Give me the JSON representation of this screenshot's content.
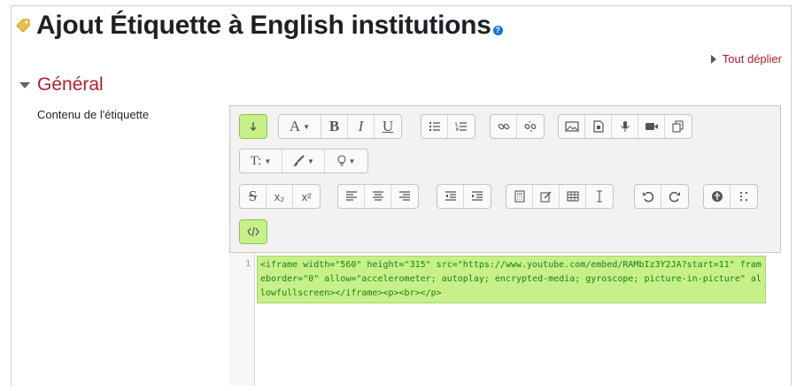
{
  "page": {
    "title": "Ajout Étiquette à English institutions",
    "help_icon": "?",
    "expand_all": "Tout déplier"
  },
  "section": {
    "title": "Général",
    "field_label": "Contenu de l'étiquette"
  },
  "toolbar": {
    "font_label": "A",
    "bold_label": "B",
    "italic_label": "I",
    "underline_label": "U",
    "style_label": "T:",
    "subscript_label": "x₂",
    "superscript_label": "x²"
  },
  "editor": {
    "line_number": "1",
    "code": "<iframe width=\"560\" height=\"315\" src=\"https://www.youtube.com/embed/RAMbIz3Y2JA?start=11\" frameborder=\"0\" allow=\"accelerometer; autoplay; encrypted-media; gyroscope; picture-in-picture\" allowfullscreen></iframe><p><br></p>"
  },
  "colors": {
    "accent_red": "#b01f2d",
    "active_green": "#c7f089",
    "help_blue": "#1177d1"
  }
}
